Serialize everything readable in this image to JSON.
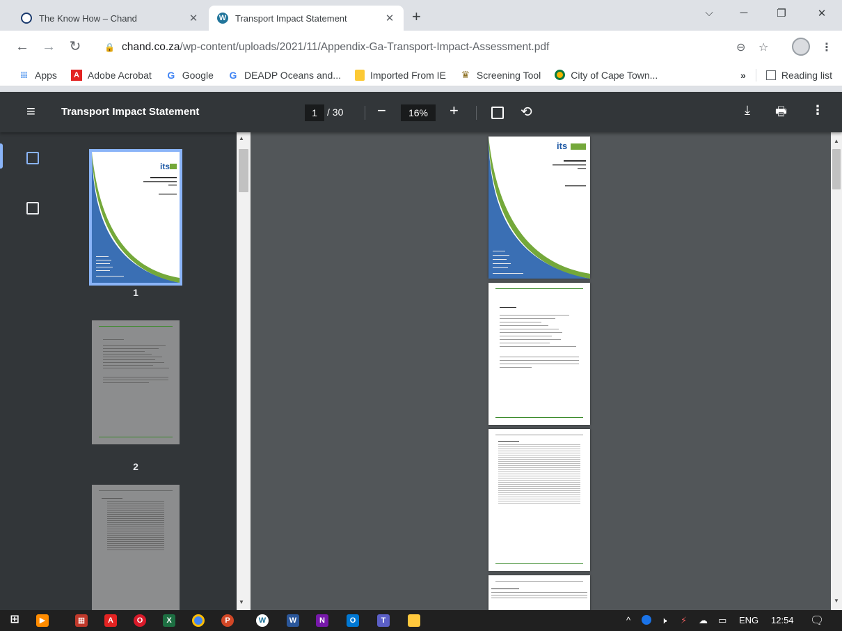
{
  "tabs": [
    {
      "title": "The Know How – Chand",
      "icon": "snowflake-favicon"
    },
    {
      "title": "Transport Impact Statement",
      "icon": "wordpress-favicon"
    }
  ],
  "address": {
    "domain": "chand.co.za",
    "path": "/wp-content/uploads/2021/11/Appendix-Ga-Transport-Impact-Assessment.pdf"
  },
  "bookmarks": [
    "Apps",
    "Adobe Acrobat",
    "Google",
    "DEADP Oceans and...",
    "Imported From IE",
    "Screening Tool",
    "City of Cape Town..."
  ],
  "bookmarks_overflow": "»",
  "reading_list": "Reading list",
  "pdf": {
    "title": "Transport Impact Statement",
    "page": "1",
    "total": "/ 30",
    "zoom": "16%"
  },
  "thumbnails": [
    "1",
    "2"
  ],
  "taskbar": {
    "lang": "ENG",
    "time": "12:54"
  }
}
